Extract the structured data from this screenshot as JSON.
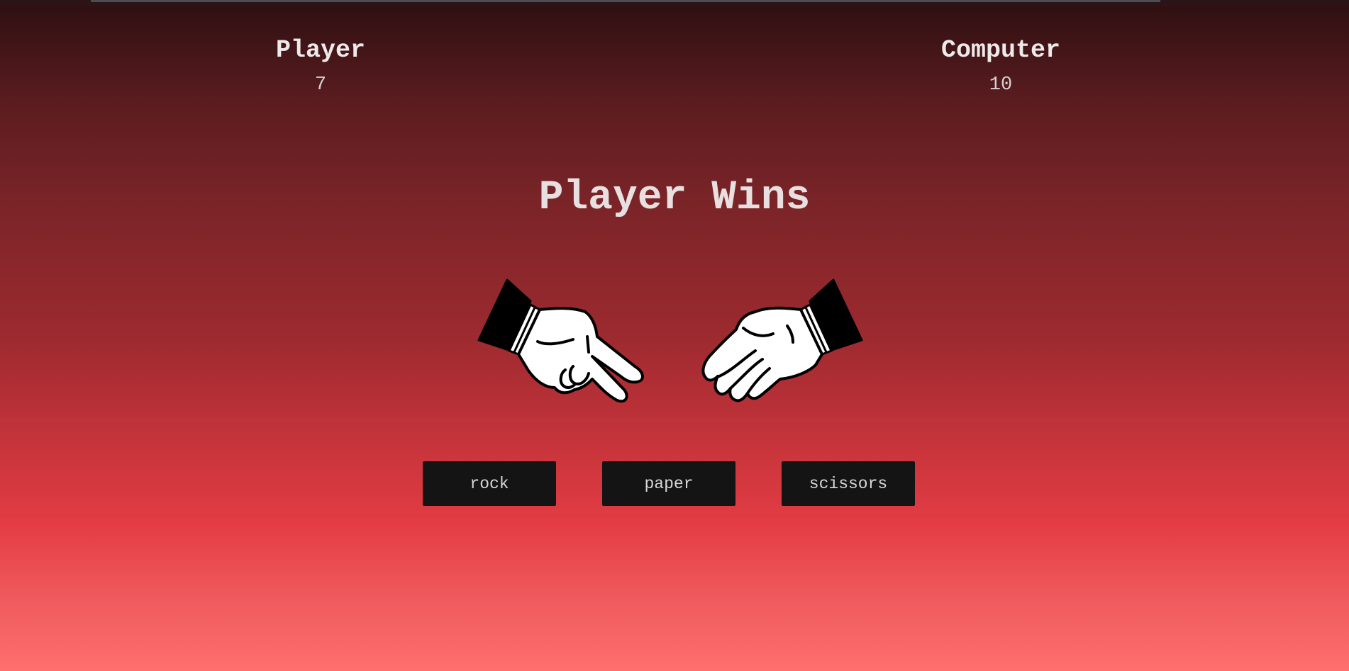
{
  "scoreboard": {
    "player": {
      "label": "Player",
      "score": "7"
    },
    "computer": {
      "label": "Computer",
      "score": "10"
    }
  },
  "result": {
    "text": "Player Wins"
  },
  "hands": {
    "player": {
      "gesture": "scissors",
      "icon": "scissors-hand-icon"
    },
    "computer": {
      "gesture": "paper",
      "icon": "paper-hand-icon"
    }
  },
  "choices": [
    {
      "label": "rock"
    },
    {
      "label": "paper"
    },
    {
      "label": "scissors"
    }
  ],
  "colors": {
    "background_top": "#2d0f11",
    "background_bottom": "#ff6f6e",
    "button_bg": "#141414",
    "text": "#e5e5e5"
  }
}
